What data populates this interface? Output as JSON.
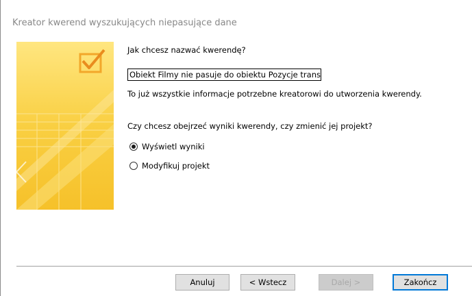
{
  "dialog": {
    "title": "Kreator kwerend wyszukujących niepasujące dane"
  },
  "form": {
    "name_question": "Jak chcesz nazwać kwerendę?",
    "name_value": "Obiekt Filmy nie pasuje do obiektu Pozycje transakcji",
    "info_text": "To już wszystkie informacje potrzebne kreatorowi do utworzenia kwerendy.",
    "choice_question": "Czy chcesz obejrzeć wyniki kwerendy, czy zmienić jej projekt?",
    "options": [
      {
        "label": "Wyświetl wyniki",
        "selected": true
      },
      {
        "label": "Modyfikuj projekt",
        "selected": false
      }
    ]
  },
  "buttons": {
    "cancel": "Anuluj",
    "back": "< Wstecz",
    "next": "Dalej >",
    "finish": "Zakończ"
  },
  "colors": {
    "title_gray": "#888888",
    "banner_yellow": "#f7c83b",
    "default_button_border": "#0078d7"
  }
}
